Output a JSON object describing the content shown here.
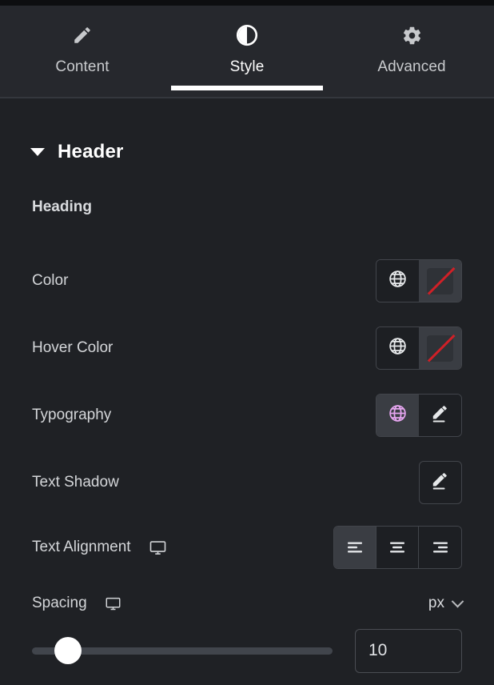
{
  "tabs": [
    {
      "label": "Content",
      "icon": "pencil-icon",
      "active": false
    },
    {
      "label": "Style",
      "icon": "contrast-icon",
      "active": true
    },
    {
      "label": "Advanced",
      "icon": "gear-icon",
      "active": false
    }
  ],
  "section": {
    "title": "Header",
    "collapsed": false
  },
  "group": {
    "label": "Heading"
  },
  "controls": {
    "color": {
      "label": "Color",
      "globe_icon": "globe-icon",
      "value_icon": "no-color-swatch",
      "accent": false
    },
    "hover_color": {
      "label": "Hover Color",
      "globe_icon": "globe-icon",
      "value_icon": "no-color-swatch",
      "accent": false
    },
    "typography": {
      "label": "Typography",
      "globe_icon": "globe-icon",
      "edit_icon": "pencil-edit-icon",
      "accent": true
    },
    "text_shadow": {
      "label": "Text Shadow",
      "edit_icon": "pencil-edit-icon"
    },
    "text_alignment": {
      "label": "Text Alignment",
      "device_icon": "desktop-icon",
      "options": [
        {
          "name": "align-left",
          "label": "Left",
          "active": true
        },
        {
          "name": "align-center",
          "label": "Center",
          "active": false
        },
        {
          "name": "align-right",
          "label": "Right",
          "active": false
        }
      ]
    },
    "spacing": {
      "label": "Spacing",
      "device_icon": "desktop-icon",
      "unit": "px",
      "unit_chevron": "chevron-down-icon",
      "value": "10",
      "slider_percent": 10
    }
  },
  "colors": {
    "panel_bg": "#1f2125",
    "tabbar_bg": "#26282d",
    "accent_pink": "#e5a5ef",
    "no_color_red": "#cf2027",
    "active_white": "#ffffff",
    "control_dark": "#1d1f23",
    "control_light": "#3a3d43",
    "border": "#42454b"
  }
}
